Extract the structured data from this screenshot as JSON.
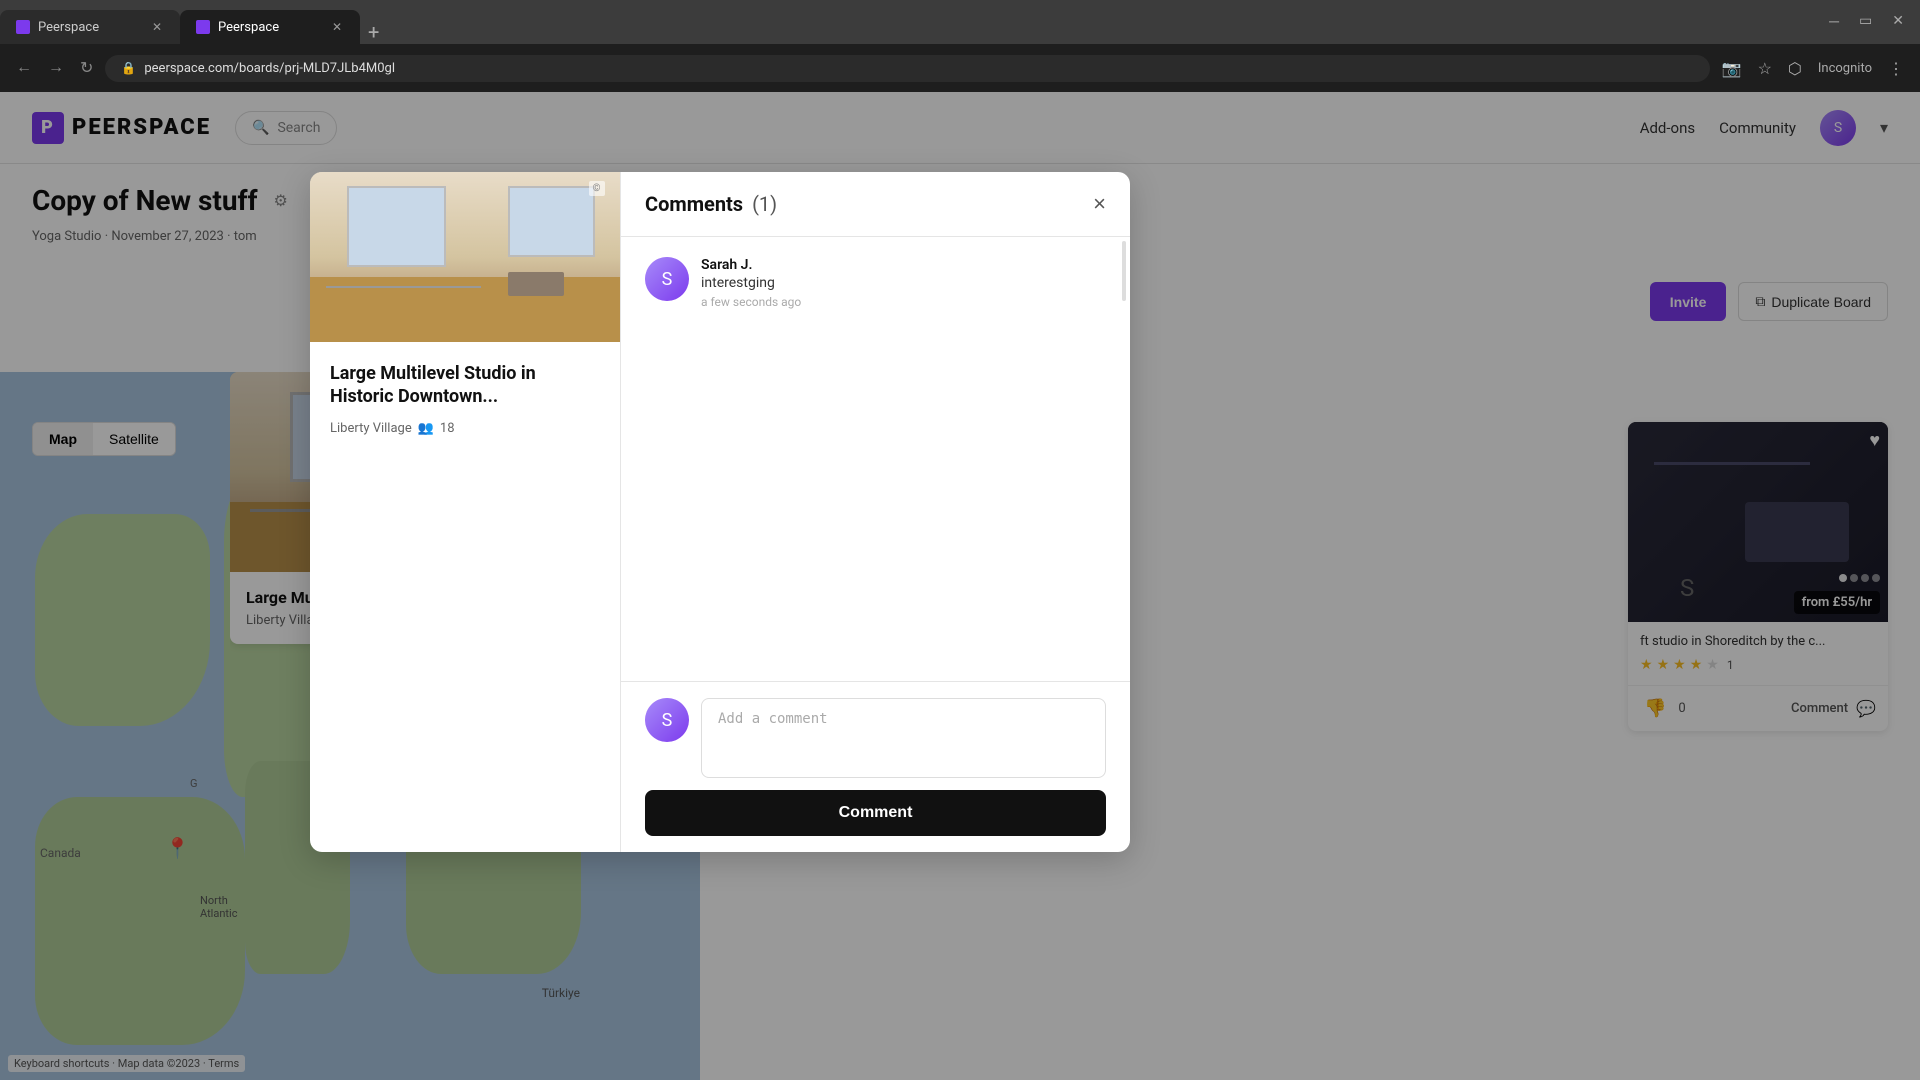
{
  "browser": {
    "tabs": [
      {
        "label": "Peerspace",
        "active": false
      },
      {
        "label": "Peerspace",
        "active": true
      }
    ],
    "address": "peerspace.com/boards/prj-MLD7JLb4M0gl",
    "new_tab_label": "+",
    "incognito_label": "Incognito"
  },
  "header": {
    "logo_text": "PEERSPACE",
    "search_placeholder": "Search",
    "nav_items": [
      "Add-ons",
      "Community"
    ],
    "avatar_label": "User Avatar"
  },
  "board": {
    "title": "Copy of New stuff",
    "meta_yoga": "Yoga Studio",
    "meta_date": "November 27, 2023",
    "meta_owner": "tom",
    "invite_label": "Invite",
    "duplicate_label": "Duplicate Board"
  },
  "map": {
    "map_tab": "Map",
    "satellite_tab": "Satellite",
    "footer": "Keyboard shortcuts",
    "map_data_label": "Map data ©2023",
    "terms_label": "Terms"
  },
  "listing_card": {
    "title": "Large Multilevel Studio in Historic Downtown...",
    "location": "Liberty Village",
    "capacity": "18"
  },
  "right_card": {
    "title": "ft studio in Shoreditch by the c...",
    "price": "from £55/hr",
    "rating_count": "1",
    "vote_count": "0",
    "comment_label": "Comment",
    "heart": "♡"
  },
  "comments_modal": {
    "title": "Comments",
    "count": "(1)",
    "close_btn": "×",
    "comment": {
      "author": "Sarah J.",
      "text": "interestging",
      "time": "a few seconds ago"
    },
    "input_placeholder": "Add a comment",
    "submit_label": "Comment"
  }
}
